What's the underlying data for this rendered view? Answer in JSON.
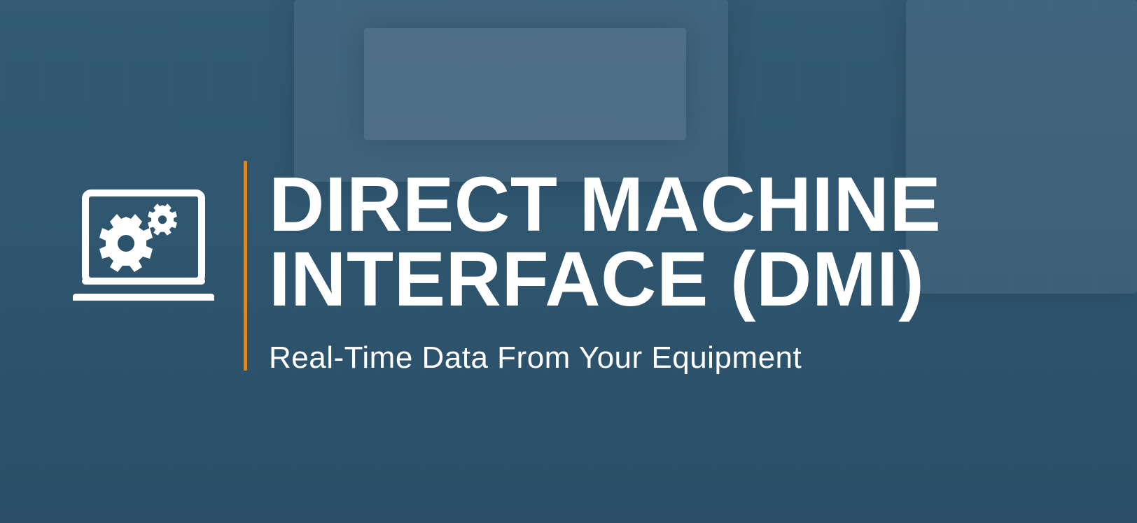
{
  "hero": {
    "headline_line1": "DIRECT MACHINE",
    "headline_line2": "INTERFACE (DMI)",
    "subheadline": "Real-Time Data From Your Equipment",
    "icon_name": "laptop-gears-icon",
    "accent_color": "#d88a2b",
    "text_color": "#ffffff"
  }
}
